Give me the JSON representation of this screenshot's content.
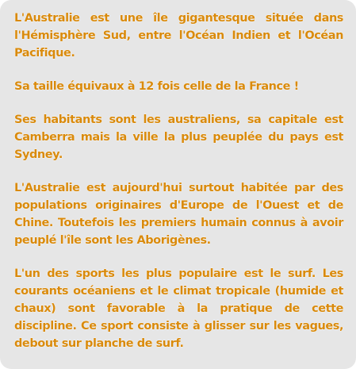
{
  "paragraphs": [
    "L'Australie est une île gigantesque située dans l'Hémisphère Sud, entre l'Océan Indien et l'Océan Pacifique.",
    "Sa taille équivaux à 12 fois celle de la France !",
    "Ses habitants sont les australiens, sa capitale est Camberra mais la ville la plus peuplée du pays est Sydney.",
    "L'Australie est aujourd'hui surtout habitée par des populations originaires d'Europe de l'Ouest et de Chine. Toutefois les premiers humain connus à avoir peuplé l'île sont les Aborigènes.",
    "L'un des sports les plus populaire est le surf. Les courants océaniens et le climat tropicale (humide et chaux) sont favorable à la pratique de cette discipline. Ce sport consiste à glisser sur les vagues, debout sur planche de surf."
  ],
  "colors": {
    "text": "#d98a0c",
    "card_background": "#e6e6e6"
  }
}
